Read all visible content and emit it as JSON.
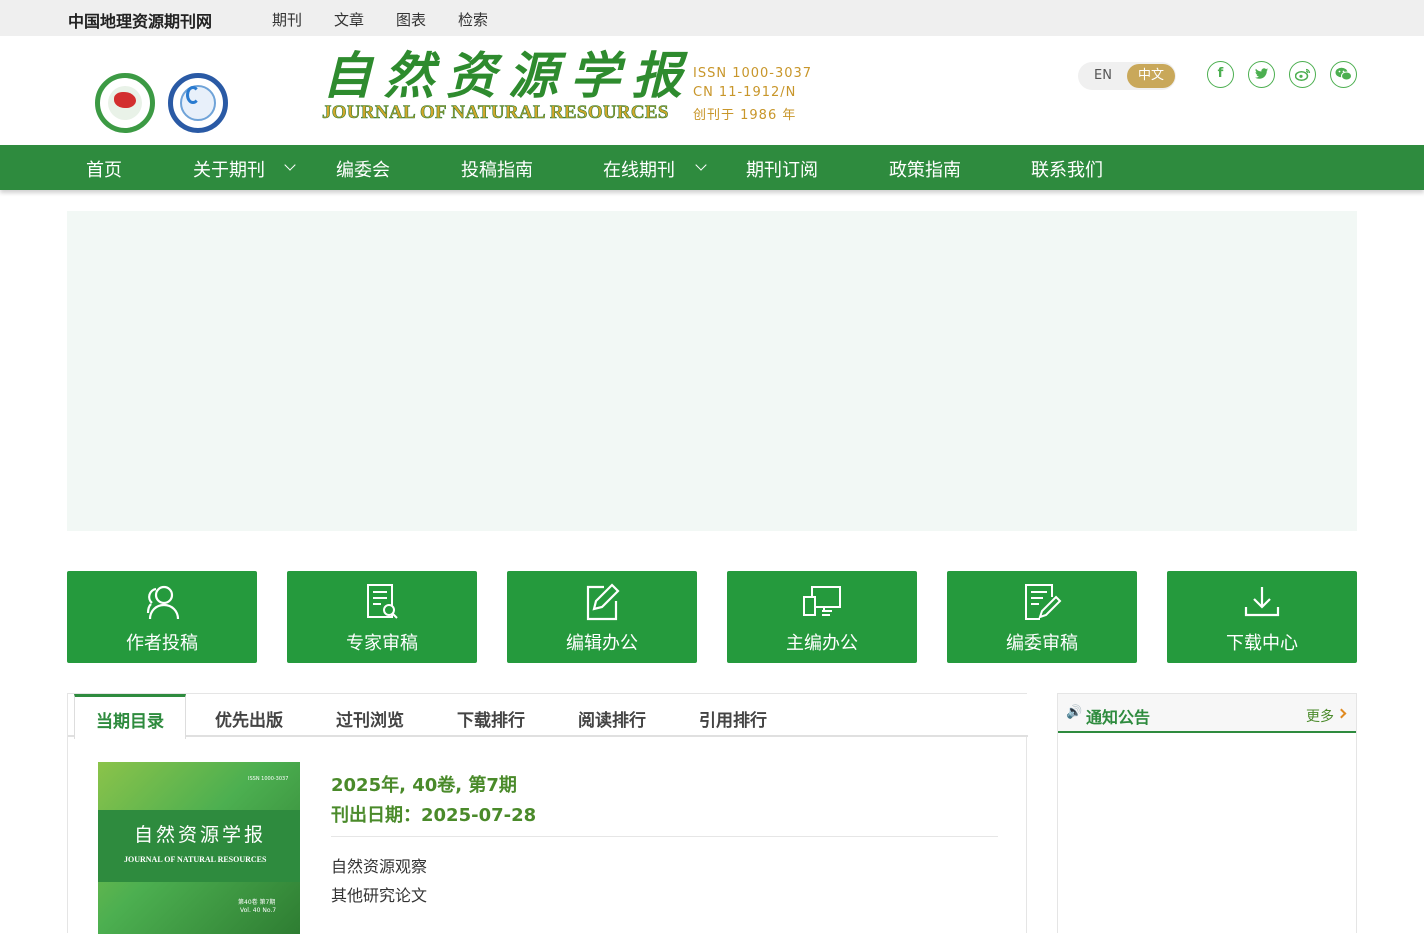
{
  "topbar": {
    "site_name": "中国地理资源期刊网",
    "links": [
      "期刊",
      "文章",
      "图表",
      "检索"
    ]
  },
  "header": {
    "title_cn": "自然资源学报",
    "title_en": "JOURNAL OF NATURAL RESOURCES",
    "issn": "ISSN 1000-3037",
    "cn": "CN 11-1912/N",
    "founded": "创刊于 1986 年",
    "lang_en": "EN",
    "lang_zh": "中文",
    "social_icons": [
      "facebook-icon",
      "twitter-icon",
      "weibo-icon",
      "wechat-icon"
    ]
  },
  "nav": {
    "items": [
      "首页",
      "关于期刊",
      "编委会",
      "投稿指南",
      "在线期刊",
      "期刊订阅",
      "政策指南",
      "联系我们"
    ]
  },
  "quick_links": [
    {
      "label": "作者投稿",
      "icon": "author-icon"
    },
    {
      "label": "专家审稿",
      "icon": "review-document-icon"
    },
    {
      "label": "编辑办公",
      "icon": "edit-icon"
    },
    {
      "label": "主编办公",
      "icon": "monitor-devices-icon"
    },
    {
      "label": "编委审稿",
      "icon": "document-pen-icon"
    },
    {
      "label": "下载中心",
      "icon": "download-icon"
    }
  ],
  "tabs": [
    "当期目录",
    "优先出版",
    "过刊浏览",
    "下载排行",
    "阅读排行",
    "引用排行"
  ],
  "current_issue": {
    "issue": "2025年, 40卷, 第7期",
    "pub_date": "刊出日期：2025-07-28",
    "sections": [
      "自然资源观察",
      "其他研究论文"
    ],
    "cover": {
      "title_cn": "自然资源学报",
      "title_en": "JOURNAL OF NATURAL RESOURCES",
      "issn_small": "ISSN 1000-3037",
      "vol_cn": "第40卷 第7期",
      "vol_en": "Vol. 40  No.7"
    }
  },
  "notice": {
    "title": "通知公告",
    "more": "更多"
  },
  "colors": {
    "primary_green": "#2e8b3e",
    "button_green": "#259a3d",
    "gold": "#c9a85a",
    "banner_bg": "#f2f8f5"
  }
}
